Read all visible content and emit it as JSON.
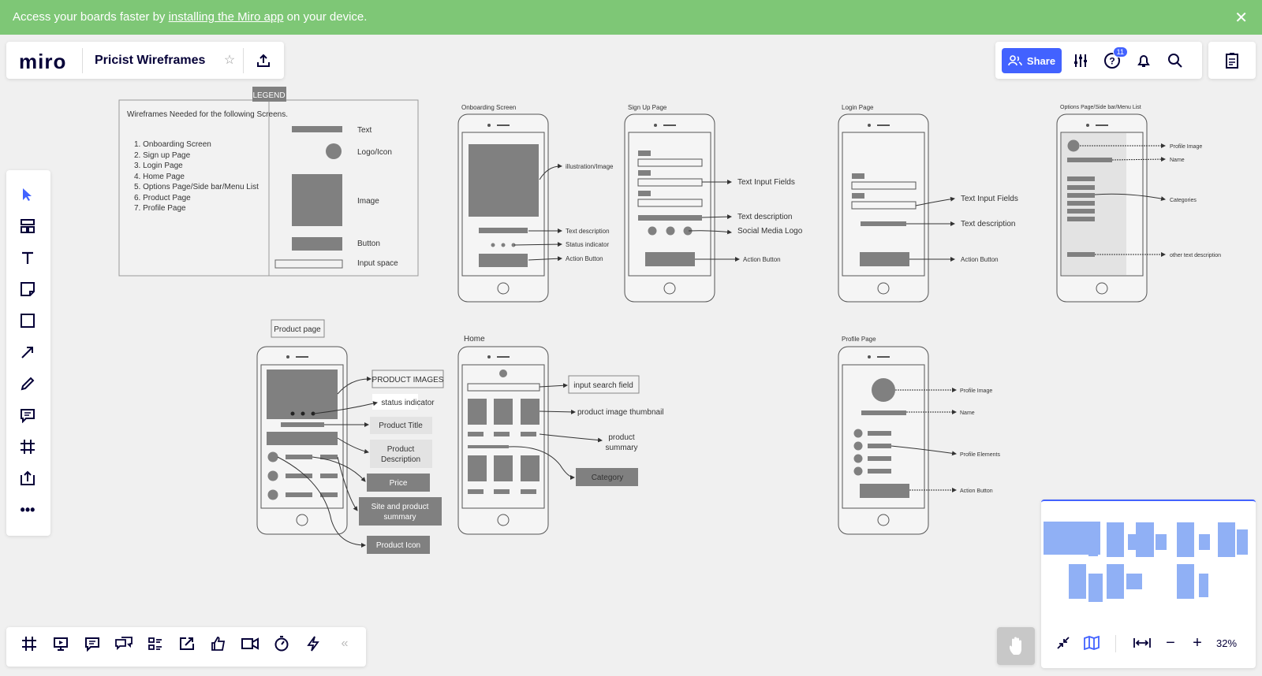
{
  "banner": {
    "prefix": "Access your boards faster by ",
    "link": "installing the Miro app",
    "suffix": " on your device.",
    "close_icon": "close-icon"
  },
  "app": {
    "logo": "miro",
    "board_title": "Pricist Wireframes",
    "share_label": "Share",
    "help_badge": "11",
    "zoom": "32%"
  },
  "colors": {
    "banner": "#7ec776",
    "accent": "#4262ff",
    "wire_fill": "#808080",
    "canvas": "#f0f0f0"
  },
  "left_toolbar": {
    "tools": [
      "select-tool",
      "templates-tool",
      "text-tool",
      "sticky-note-tool",
      "shape-tool",
      "arrow-tool",
      "pen-tool",
      "comment-tool",
      "frame-tool",
      "upload-tool",
      "more-tools"
    ]
  },
  "bottom_toolbar": {
    "tools": [
      "frames-tool",
      "presentation-tool",
      "comments-tool",
      "chat-tool",
      "cards-tool",
      "share-screen-tool",
      "reactions-tool",
      "video-tool",
      "timer-tool",
      "lightning-tool",
      "collapse-tool"
    ]
  },
  "legend": {
    "badge": "LEGEND",
    "intro": "Wireframes Needed for the following Screens.",
    "list": [
      "1. Onboarding Screen",
      "2. Sign up Page",
      "3. Login Page",
      "4. Home Page",
      "5. Options Page/Side bar/Menu List",
      "6. Product Page",
      "7. Profile Page"
    ],
    "keys": [
      "Text",
      "Logo/Icon",
      "Image",
      "Button",
      "Input space"
    ]
  },
  "screens": {
    "onboarding": {
      "title": "Onboarding Screen",
      "labels": [
        "illustration/Image",
        "Text description",
        "Status indicator",
        "Action Button"
      ]
    },
    "signup": {
      "title": "Sign Up Page",
      "labels": [
        "Text Input Fields",
        "Text description",
        "Social Media Logo",
        "Action Button"
      ]
    },
    "login": {
      "title": "Login Page",
      "labels": [
        "Text Input Fields",
        "Text description",
        "Action Button"
      ]
    },
    "options": {
      "title": "Options Page/Side bar/Menu List",
      "labels": [
        "Profile Image",
        "Name",
        "Categories",
        "other text description"
      ]
    },
    "product": {
      "title": "Product page",
      "labels": [
        "PRODUCT IMAGES",
        "status indicator",
        "Product Title",
        "Product",
        "Description",
        "Price",
        "Site and product",
        "summary",
        "Product Icon"
      ]
    },
    "home": {
      "title": "Home",
      "labels": [
        "input search field",
        "product image thumbnail",
        "product",
        "summary",
        "Category"
      ]
    },
    "profile": {
      "title": "Profile Page",
      "labels": [
        "Profile Image",
        "Name",
        "Profile Elements",
        "Action Button"
      ]
    }
  }
}
